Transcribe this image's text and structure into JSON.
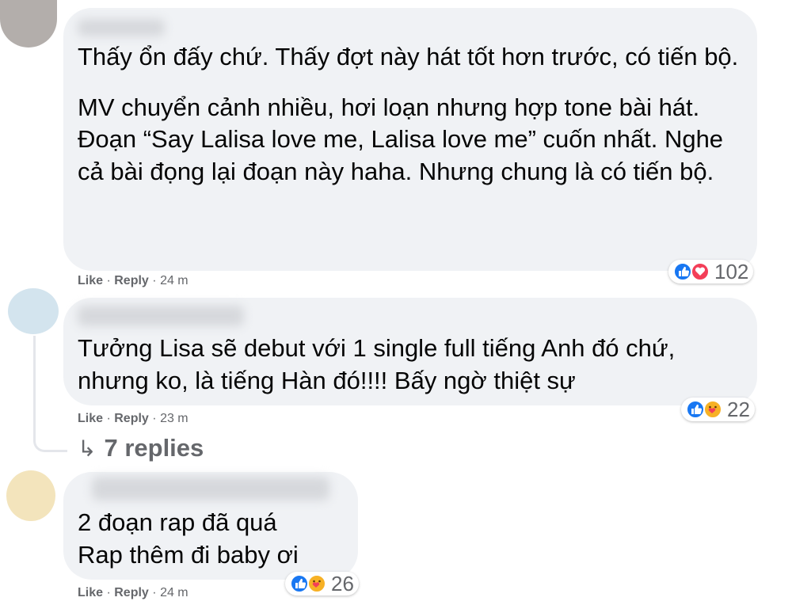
{
  "comments": [
    {
      "lines": [
        "Thấy ổn đấy chứ. Thấy đợt này hát tốt hơn trước, có tiến bộ.",
        "MV chuyển cảnh nhiều, hơi loạn nhưng hợp tone bài hát. Đoạn “Say Lalisa love me, Lalisa love me” cuốn nhất. Nghe cả bài đọng lại đoạn này haha. Nhưng chung là có tiến bộ."
      ],
      "actions": {
        "like": "Like",
        "reply": "Reply",
        "time": "24 m"
      },
      "reactions": {
        "types": [
          "like",
          "love"
        ],
        "count": "102"
      }
    },
    {
      "lines": [
        "Tưởng Lisa sẽ debut với 1 single full tiếng Anh đó chứ, nhưng ko, là tiếng Hàn đó!!!! Bấy ngờ thiệt sự"
      ],
      "actions": {
        "like": "Like",
        "reply": "Reply",
        "time": "23 m"
      },
      "reactions": {
        "types": [
          "like",
          "care"
        ],
        "count": "22"
      },
      "replies_label": "7 replies"
    },
    {
      "lines": [
        "2 đoạn rap đã quá",
        "Rap thêm đi baby ơi"
      ],
      "actions": {
        "like": "Like",
        "reply": "Reply",
        "time": "24 m"
      },
      "reactions": {
        "types": [
          "like",
          "care"
        ],
        "count": "26"
      }
    }
  ],
  "separator": "·",
  "colors": {
    "bubble": "#f0f2f5",
    "meta": "#65676b",
    "like_blue": "#1877f2",
    "love_red": "#f33e58",
    "care_yellow": "#f7b125"
  }
}
